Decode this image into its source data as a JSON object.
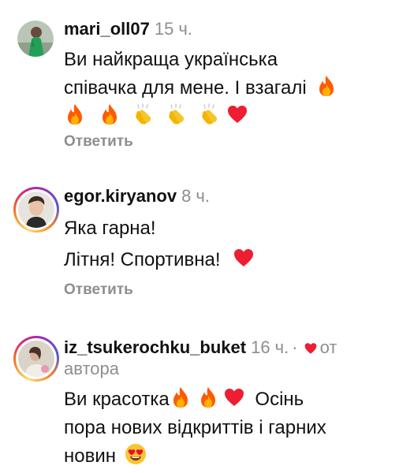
{
  "comments": [
    {
      "username": "mari_oll07",
      "time": "15 ч.",
      "text_line1": "Ви найкраща українська",
      "text_line2": "співачка для мене. І взагалі",
      "reply_label": "Ответить",
      "avatar_icon": "user-avatar-woman-green-dress",
      "emoji_line2": [
        "fire"
      ],
      "emoji_line3": [
        "fire",
        "fire",
        "clapping-hands",
        "clapping-hands",
        "clapping-hands",
        "red-heart"
      ]
    },
    {
      "username": "egor.kiryanov",
      "time": "8 ч.",
      "text_line1": "Яка гарна!",
      "text_line2": "Літня! Спортивна!",
      "reply_label": "Ответить",
      "avatar_icon": "user-avatar-man-story-ring",
      "emoji_line2": [
        "red-heart"
      ]
    },
    {
      "username": "iz_tsukerochku_buket",
      "time": "16 ч.",
      "separator": "·",
      "author_label": "от",
      "author_label2": "автора",
      "text_line1_a": "Ви красотка",
      "text_line1_b": "Осінь",
      "text_line2": "пора нових відкриттів і гарних",
      "text_line3": "новин",
      "avatar_icon": "user-avatar-woman-story-ring",
      "emoji_line1": [
        "fire",
        "fire",
        "red-heart"
      ],
      "emoji_line3": [
        "heart-eyes-face"
      ],
      "liked_by_author_icon": "small-red-heart-icon"
    }
  ],
  "colors": {
    "text": "#111111",
    "muted": "#8e8e8e",
    "heart": "#ed1d32",
    "fire": "#ff6a00"
  }
}
